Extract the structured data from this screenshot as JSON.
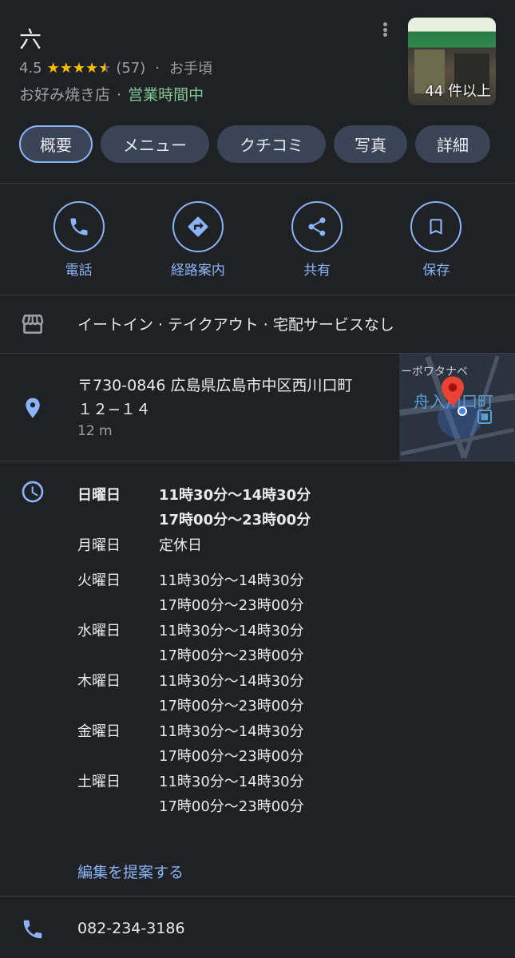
{
  "place": {
    "name": "六",
    "rating": "4.5",
    "review_count": "(57)",
    "price": "お手頃",
    "category": "お好み焼き店",
    "open_status": "営業時間中",
    "photo_count": "44 件以上"
  },
  "tabs": [
    {
      "label": "概要"
    },
    {
      "label": "メニュー"
    },
    {
      "label": "クチコミ"
    },
    {
      "label": "写真"
    },
    {
      "label": "詳細"
    }
  ],
  "actions": [
    {
      "label": "電話",
      "icon": "phone-icon"
    },
    {
      "label": "経路案内",
      "icon": "directions-icon"
    },
    {
      "label": "共有",
      "icon": "share-icon"
    },
    {
      "label": "保存",
      "icon": "bookmark-icon"
    }
  ],
  "services": "イートイン · テイクアウト · 宅配サービスなし",
  "address": {
    "line1": "〒730-0846 広島県広島市中区西川口町",
    "line2": "１２−１４",
    "distance": "12 m"
  },
  "map": {
    "label_top": "ーポワタナベ",
    "label_station": "舟入川口町"
  },
  "hours": [
    {
      "day": "日曜日",
      "t1": "11時30分〜14時30分",
      "t2": "17時00分〜23時00分",
      "bold": true
    },
    {
      "day": "月曜日",
      "t1": "定休日",
      "t2": ""
    },
    {
      "day": "火曜日",
      "t1": "11時30分〜14時30分",
      "t2": "17時00分〜23時00分"
    },
    {
      "day": "水曜日",
      "t1": "11時30分〜14時30分",
      "t2": "17時00分〜23時00分"
    },
    {
      "day": "木曜日",
      "t1": "11時30分〜14時30分",
      "t2": "17時00分〜23時00分"
    },
    {
      "day": "金曜日",
      "t1": "11時30分〜14時30分",
      "t2": "17時00分〜23時00分"
    },
    {
      "day": "土曜日",
      "t1": "11時30分〜14時30分",
      "t2": "17時00分〜23時00分"
    }
  ],
  "suggest_edit": "編集を提案する",
  "phone": "082-234-3186",
  "colors": {
    "background": "#202124",
    "accent": "#8ab4f8",
    "open": "#81c995",
    "star": "#fbbc04",
    "tab_bg": "#394457"
  }
}
